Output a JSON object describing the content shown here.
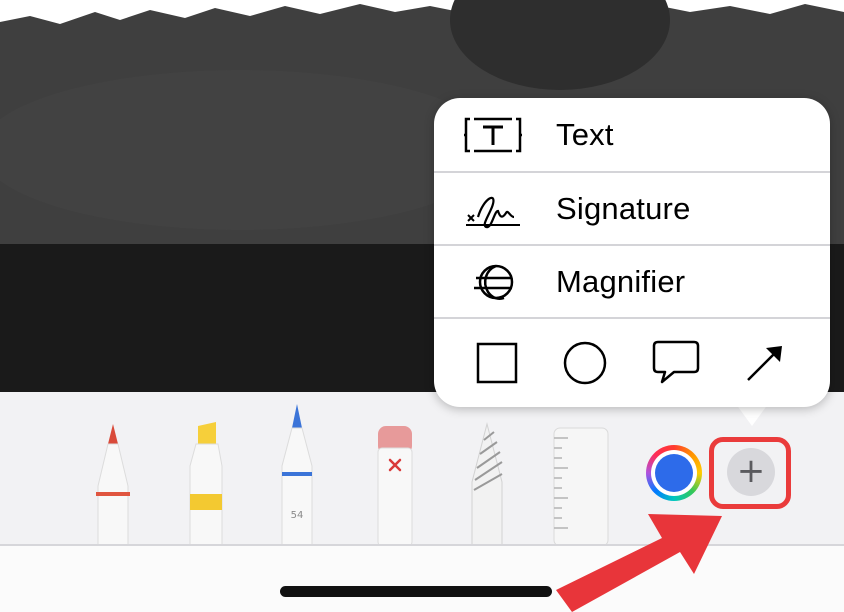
{
  "menu": {
    "items": [
      {
        "label": "Text",
        "icon": "text-box-icon"
      },
      {
        "label": "Signature",
        "icon": "signature-icon"
      },
      {
        "label": "Magnifier",
        "icon": "magnifier-icon"
      }
    ],
    "shapes": [
      "square-icon",
      "circle-icon",
      "speech-bubble-icon",
      "arrow-icon"
    ]
  },
  "toolbar": {
    "tools": [
      "pen-tool",
      "highlighter-tool",
      "pencil-tool",
      "eraser-tool",
      "lasso-tool",
      "ruler-tool"
    ],
    "pencil_width": "54",
    "add_label": "+",
    "selected_color": "#2d6bea"
  },
  "annotation": {
    "highlight_color": "#ea3b3b"
  }
}
